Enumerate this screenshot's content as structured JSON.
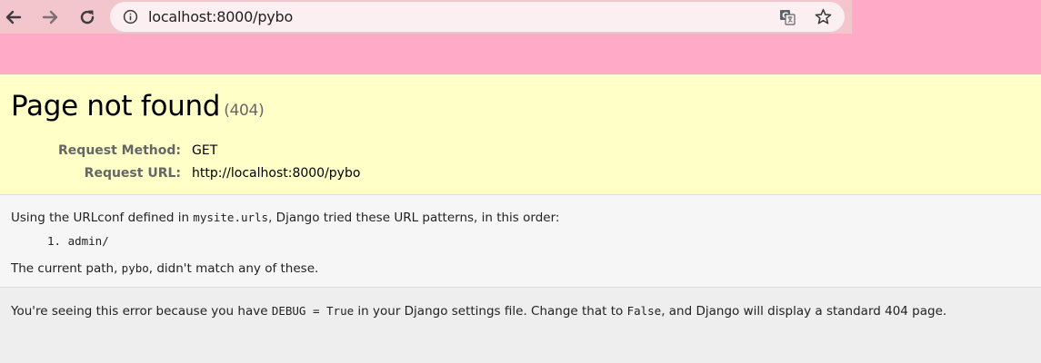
{
  "browser": {
    "url": "localhost:8000/pybo",
    "icons": [
      "back-arrow-icon",
      "forward-arrow-icon",
      "reload-icon",
      "info-icon",
      "translate-icon",
      "star-icon"
    ]
  },
  "error": {
    "title": "Page not found",
    "status_code": "(404)",
    "meta": [
      {
        "key": "Request Method:",
        "value": "GET"
      },
      {
        "key": "Request URL:",
        "value": "http://localhost:8000/pybo"
      }
    ]
  },
  "info": {
    "line1_before": "Using the URLconf defined in ",
    "urlconf": "mysite.urls",
    "line1_after": ", Django tried these URL patterns, in this order:",
    "patterns": [
      "1. admin/"
    ],
    "line2_before": "The current path, ",
    "path": "pybo",
    "line2_after": ", didn't match any of these."
  },
  "explanation": {
    "before": "You're seeing this error because you have ",
    "debug": "DEBUG = True",
    "middle": " in your Django settings file. Change that to ",
    "false": "False",
    "after": ", and Django will display a standard 404 page."
  },
  "colors": {
    "toolbar": "#ffabc7",
    "summary_bg": "#ffffc8",
    "info_bg": "#f6f6f6",
    "explanation_bg": "#eeeeee"
  }
}
